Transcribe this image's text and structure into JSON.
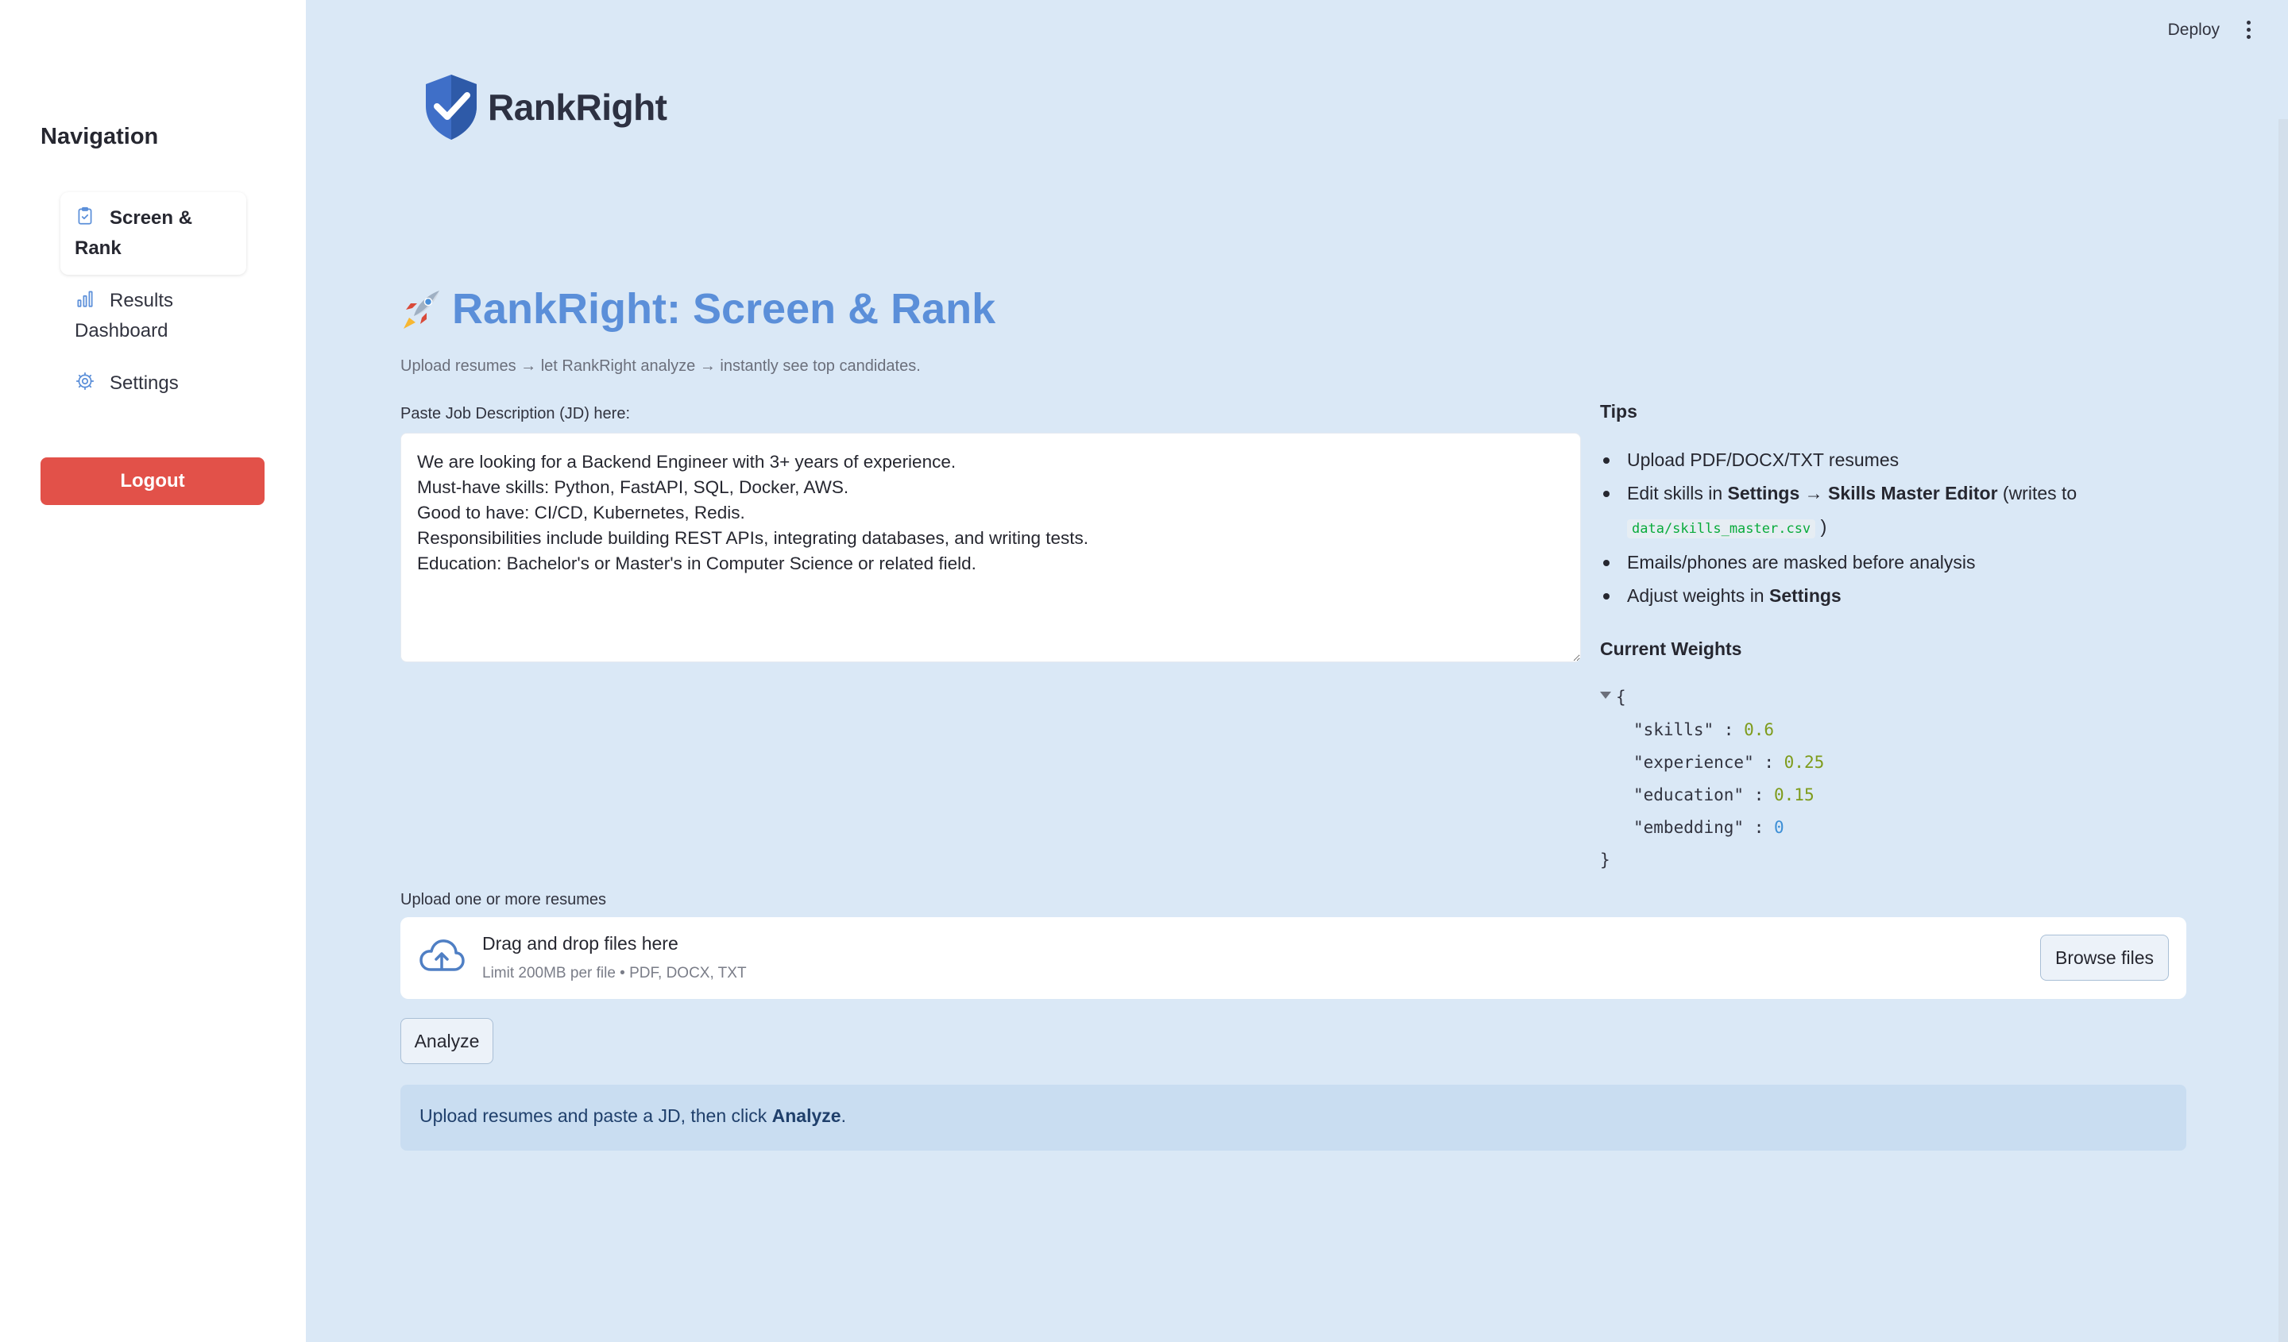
{
  "sidebar": {
    "title": "Navigation",
    "items": [
      {
        "label_line1": "Screen &",
        "label_line2": "Rank",
        "icon": "clipboard-icon",
        "active": true
      },
      {
        "label_line1": "Results",
        "label_line2": "Dashboard",
        "icon": "bar-chart-icon",
        "active": false
      },
      {
        "label_line1": "Settings",
        "label_line2": "",
        "icon": "gear-icon",
        "active": false
      }
    ],
    "logout_label": "Logout"
  },
  "topbar": {
    "deploy_label": "Deploy",
    "menu_icon": "kebab-menu-icon"
  },
  "logo": {
    "text": "RankRight",
    "icon": "shield-check-icon"
  },
  "header": {
    "title": "RankRight: Screen & Rank",
    "title_icon": "rocket-icon",
    "subtitle": "Upload resumes → let RankRight analyze → instantly see top candidates."
  },
  "jd": {
    "label": "Paste Job Description (JD) here:",
    "value": "We are looking for a Backend Engineer with 3+ years of experience.\nMust-have skills: Python, FastAPI, SQL, Docker, AWS.\nGood to have: CI/CD, Kubernetes, Redis.\nResponsibilities include building REST APIs, integrating databases, and writing tests.\nEducation: Bachelor's or Master's in Computer Science or related field."
  },
  "tips": {
    "title": "Tips",
    "item1": "Upload PDF/DOCX/TXT resumes",
    "item2_pre": "Edit skills in ",
    "item2_bold": "Settings → Skills Master Editor",
    "item2_post": " (writes to",
    "item2_code": "data/skills_master.csv",
    "item2_close": ")",
    "item3": "Emails/phones are masked before analysis",
    "item4_pre": "Adjust weights in ",
    "item4_bold": "Settings"
  },
  "weights": {
    "title": "Current Weights",
    "open_brace": "{",
    "close_brace": "}",
    "entries": [
      {
        "key": "\"skills\"",
        "value": "0.6"
      },
      {
        "key": "\"experience\"",
        "value": "0.25"
      },
      {
        "key": "\"education\"",
        "value": "0.15"
      },
      {
        "key": "\"embedding\"",
        "value": "0"
      }
    ],
    "value_color": "#7e9b1b",
    "zero_color": "#3d8fd6"
  },
  "upload": {
    "label": "Upload one or more resumes",
    "drop_text": "Drag and drop files here",
    "limit_text": "Limit 200MB per file • PDF, DOCX, TXT",
    "browse_label": "Browse files",
    "icon": "cloud-upload-icon"
  },
  "analyze_label": "Analyze",
  "info": {
    "text_pre": "Upload resumes and paste a JD, then click ",
    "text_bold": "Analyze",
    "text_post": "."
  },
  "colors": {
    "page_bg": "#dae8f6",
    "sidebar_bg": "#ffffff",
    "accent": "#5b8fd9",
    "logout": "#e25149",
    "info_bg": "#c9ddf1"
  }
}
